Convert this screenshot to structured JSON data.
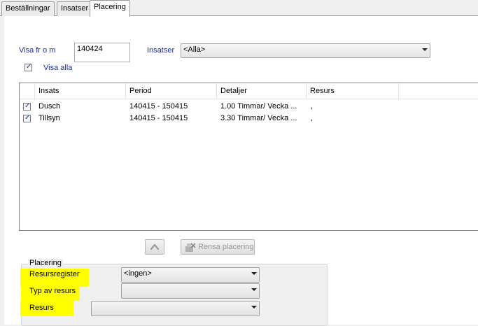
{
  "tabs": [
    {
      "label": "Beställningar"
    },
    {
      "label": "Insatser"
    },
    {
      "label": "Placering"
    }
  ],
  "filter": {
    "visa_from_label": "Visa fr o m",
    "visa_from_value": "140424",
    "insatser_label": "Insatser",
    "insatser_value": "<Alla>",
    "visa_alla_label": "Visa alla",
    "visa_alla_checked": true
  },
  "list": {
    "columns": [
      "Insats",
      "Period",
      "Detaljer",
      "Resurs"
    ],
    "rows": [
      {
        "checked": true,
        "insats": "Dusch",
        "period": "140415 - 150415",
        "detaljer": "1.00 Timmar/ Vecka  ...",
        "resurs": ","
      },
      {
        "checked": true,
        "insats": "Tillsyn",
        "period": "140415 - 150415",
        "detaljer": "3.30 Timmar/ Vecka  ...",
        "resurs": ","
      }
    ]
  },
  "actions": {
    "rensa_label": "Rensa placering"
  },
  "placering": {
    "title": "Placering",
    "resursregister_label": "Resursregister",
    "resursregister_value": "<ingen>",
    "typ_label": "Typ av resurs",
    "typ_value": "",
    "resurs_label": "Resurs",
    "resurs_value": ""
  },
  "colors": {
    "highlight": "#ffff00",
    "label_blue": "#1c2ca0"
  },
  "icons": {
    "up": "up-arrow-icon",
    "rensa": "clear-placement-icon",
    "dropdown": "chevron-down-icon",
    "check": "checkmark-icon"
  }
}
